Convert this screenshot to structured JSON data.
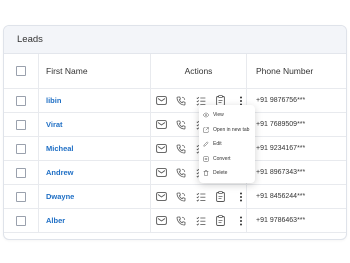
{
  "panel": {
    "title": "Leads"
  },
  "table": {
    "headers": {
      "name": "First Name",
      "actions": "Actions",
      "phone": "Phone Number"
    },
    "rows": [
      {
        "name": "libin",
        "phone": "+91 9876756***"
      },
      {
        "name": "Virat",
        "phone": "+91 7689509***"
      },
      {
        "name": "Micheal",
        "phone": "+91 9234167***"
      },
      {
        "name": "Andrew",
        "phone": "+91 8967343***"
      },
      {
        "name": "Dwayne",
        "phone": "+91 8456244***"
      },
      {
        "name": "Alber",
        "phone": "+91 9786463***"
      }
    ]
  },
  "context_menu": {
    "items": [
      {
        "label": "View",
        "icon": "eye-icon"
      },
      {
        "label": "Open in new tab",
        "icon": "external-link-icon"
      },
      {
        "label": "Edit",
        "icon": "pencil-icon"
      },
      {
        "label": "Convert",
        "icon": "convert-icon"
      },
      {
        "label": "Delete",
        "icon": "trash-icon"
      }
    ]
  },
  "colors": {
    "name_link": "#1f6fc5",
    "header_bg": "#f3f5f9",
    "border": "#dfe3ea"
  }
}
